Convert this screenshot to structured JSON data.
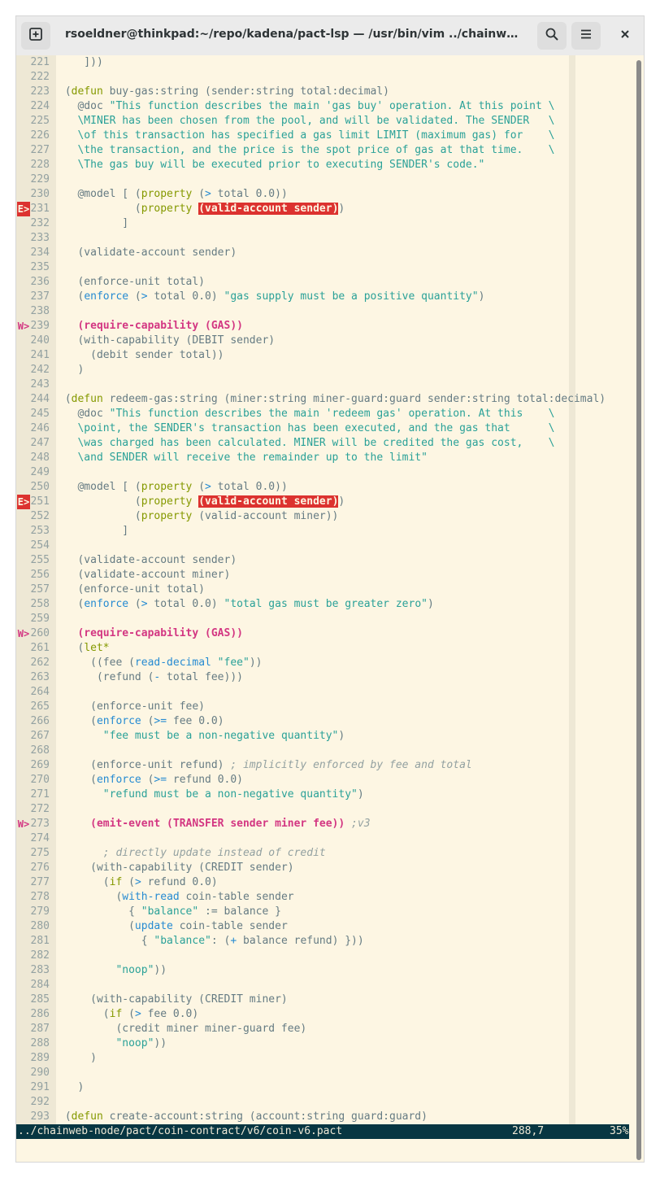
{
  "window": {
    "title": "rsoeldner@thinkpad:~/repo/kadena/pact-lsp — /usr/bin/vim ../chainweb-node/…",
    "new_tab_icon": "new-tab-icon",
    "search_icon": "search-icon",
    "menu_icon": "hamburger-menu-icon",
    "close_icon": "close-icon"
  },
  "editor": {
    "lines": [
      {
        "n": "221",
        "sign": "",
        "parts": [
          [
            "p",
            "    ]))"
          ]
        ]
      },
      {
        "n": "222",
        "sign": "",
        "parts": []
      },
      {
        "n": "223",
        "sign": "",
        "parts": [
          [
            "p",
            " ("
          ],
          [
            "k",
            "defun"
          ],
          [
            "p",
            " buy-gas:string (sender:string total:decimal)"
          ]
        ]
      },
      {
        "n": "224",
        "sign": "",
        "parts": [
          [
            "p",
            "   @doc "
          ],
          [
            "s",
            "\"This function describes the main 'gas buy' operation. At this point \\"
          ]
        ]
      },
      {
        "n": "225",
        "sign": "",
        "parts": [
          [
            "s",
            "   \\MINER has been chosen from the pool, and will be validated. The SENDER   \\"
          ]
        ]
      },
      {
        "n": "226",
        "sign": "",
        "parts": [
          [
            "s",
            "   \\of this transaction has specified a gas limit LIMIT (maximum gas) for    \\"
          ]
        ]
      },
      {
        "n": "227",
        "sign": "",
        "parts": [
          [
            "s",
            "   \\the transaction, and the price is the spot price of gas at that time.    \\"
          ]
        ]
      },
      {
        "n": "228",
        "sign": "",
        "parts": [
          [
            "s",
            "   \\The gas buy will be executed prior to executing SENDER's code.\""
          ]
        ]
      },
      {
        "n": "229",
        "sign": "",
        "parts": []
      },
      {
        "n": "230",
        "sign": "",
        "parts": [
          [
            "p",
            "   @model [ ("
          ],
          [
            "k",
            "property"
          ],
          [
            "p",
            " ("
          ],
          [
            "o",
            ">"
          ],
          [
            "p",
            " total 0.0))"
          ]
        ]
      },
      {
        "n": "231",
        "sign": "E>",
        "parts": [
          [
            "p",
            "            ("
          ],
          [
            "k",
            "property"
          ],
          [
            "p",
            " "
          ],
          [
            "e",
            "(valid-account sender)"
          ],
          [
            "p",
            ")"
          ]
        ]
      },
      {
        "n": "232",
        "sign": "",
        "parts": [
          [
            "p",
            "          ]"
          ]
        ]
      },
      {
        "n": "233",
        "sign": "",
        "parts": []
      },
      {
        "n": "234",
        "sign": "",
        "parts": [
          [
            "p",
            "   (validate-account sender)"
          ]
        ]
      },
      {
        "n": "235",
        "sign": "",
        "parts": []
      },
      {
        "n": "236",
        "sign": "",
        "parts": [
          [
            "p",
            "   (enforce-unit total)"
          ]
        ]
      },
      {
        "n": "237",
        "sign": "",
        "parts": [
          [
            "p",
            "   ("
          ],
          [
            "o",
            "enforce"
          ],
          [
            "p",
            " ("
          ],
          [
            "o",
            ">"
          ],
          [
            "p",
            " total 0.0) "
          ],
          [
            "s",
            "\"gas supply must be a positive quantity\""
          ],
          [
            "p",
            ")"
          ]
        ]
      },
      {
        "n": "238",
        "sign": "",
        "parts": []
      },
      {
        "n": "239",
        "sign": "W>",
        "parts": [
          [
            "p",
            "   "
          ],
          [
            "w",
            "(require-capability (GAS))"
          ]
        ]
      },
      {
        "n": "240",
        "sign": "",
        "parts": [
          [
            "p",
            "   (with-capability (DEBIT sender)"
          ]
        ]
      },
      {
        "n": "241",
        "sign": "",
        "parts": [
          [
            "p",
            "     (debit sender total))"
          ]
        ]
      },
      {
        "n": "242",
        "sign": "",
        "parts": [
          [
            "p",
            "   )"
          ]
        ]
      },
      {
        "n": "243",
        "sign": "",
        "parts": []
      },
      {
        "n": "244",
        "sign": "",
        "parts": [
          [
            "p",
            " ("
          ],
          [
            "k",
            "defun"
          ],
          [
            "p",
            " redeem-gas:string (miner:string miner-guard:guard sender:string total:decimal)"
          ]
        ]
      },
      {
        "n": "245",
        "sign": "",
        "parts": [
          [
            "p",
            "   @doc "
          ],
          [
            "s",
            "\"This function describes the main 'redeem gas' operation. At this    \\"
          ]
        ]
      },
      {
        "n": "246",
        "sign": "",
        "parts": [
          [
            "s",
            "   \\point, the SENDER's transaction has been executed, and the gas that      \\"
          ]
        ]
      },
      {
        "n": "247",
        "sign": "",
        "parts": [
          [
            "s",
            "   \\was charged has been calculated. MINER will be credited the gas cost,    \\"
          ]
        ]
      },
      {
        "n": "248",
        "sign": "",
        "parts": [
          [
            "s",
            "   \\and SENDER will receive the remainder up to the limit\""
          ]
        ]
      },
      {
        "n": "249",
        "sign": "",
        "parts": []
      },
      {
        "n": "250",
        "sign": "",
        "parts": [
          [
            "p",
            "   @model [ ("
          ],
          [
            "k",
            "property"
          ],
          [
            "p",
            " ("
          ],
          [
            "o",
            ">"
          ],
          [
            "p",
            " total 0.0))"
          ]
        ]
      },
      {
        "n": "251",
        "sign": "E>",
        "parts": [
          [
            "p",
            "            ("
          ],
          [
            "k",
            "property"
          ],
          [
            "p",
            " "
          ],
          [
            "e",
            "(valid-account sender)"
          ],
          [
            "p",
            ")"
          ]
        ]
      },
      {
        "n": "252",
        "sign": "",
        "parts": [
          [
            "p",
            "            ("
          ],
          [
            "k",
            "property"
          ],
          [
            "p",
            " (valid-account miner))"
          ]
        ]
      },
      {
        "n": "253",
        "sign": "",
        "parts": [
          [
            "p",
            "          ]"
          ]
        ]
      },
      {
        "n": "254",
        "sign": "",
        "parts": []
      },
      {
        "n": "255",
        "sign": "",
        "parts": [
          [
            "p",
            "   (validate-account sender)"
          ]
        ]
      },
      {
        "n": "256",
        "sign": "",
        "parts": [
          [
            "p",
            "   (validate-account miner)"
          ]
        ]
      },
      {
        "n": "257",
        "sign": "",
        "parts": [
          [
            "p",
            "   (enforce-unit total)"
          ]
        ]
      },
      {
        "n": "258",
        "sign": "",
        "parts": [
          [
            "p",
            "   ("
          ],
          [
            "o",
            "enforce"
          ],
          [
            "p",
            " ("
          ],
          [
            "o",
            ">"
          ],
          [
            "p",
            " total 0.0) "
          ],
          [
            "s",
            "\"total gas must be greater zero\""
          ],
          [
            "p",
            ")"
          ]
        ]
      },
      {
        "n": "259",
        "sign": "",
        "parts": []
      },
      {
        "n": "260",
        "sign": "W>",
        "parts": [
          [
            "p",
            "   "
          ],
          [
            "w",
            "(require-capability (GAS))"
          ]
        ]
      },
      {
        "n": "261",
        "sign": "",
        "parts": [
          [
            "p",
            "   ("
          ],
          [
            "k",
            "let*"
          ]
        ]
      },
      {
        "n": "262",
        "sign": "",
        "parts": [
          [
            "p",
            "     ((fee ("
          ],
          [
            "o",
            "read-decimal"
          ],
          [
            "p",
            " "
          ],
          [
            "s",
            "\"fee\""
          ],
          [
            "p",
            "))"
          ]
        ]
      },
      {
        "n": "263",
        "sign": "",
        "parts": [
          [
            "p",
            "      (refund ("
          ],
          [
            "o",
            "-"
          ],
          [
            "p",
            " total fee)))"
          ]
        ]
      },
      {
        "n": "264",
        "sign": "",
        "parts": []
      },
      {
        "n": "265",
        "sign": "",
        "parts": [
          [
            "p",
            "     (enforce-unit fee)"
          ]
        ]
      },
      {
        "n": "266",
        "sign": "",
        "parts": [
          [
            "p",
            "     ("
          ],
          [
            "o",
            "enforce"
          ],
          [
            "p",
            " ("
          ],
          [
            "o",
            ">="
          ],
          [
            "p",
            " fee 0.0)"
          ]
        ]
      },
      {
        "n": "267",
        "sign": "",
        "parts": [
          [
            "p",
            "       "
          ],
          [
            "s",
            "\"fee must be a non-negative quantity\""
          ],
          [
            "p",
            ")"
          ]
        ]
      },
      {
        "n": "268",
        "sign": "",
        "parts": []
      },
      {
        "n": "269",
        "sign": "",
        "parts": [
          [
            "p",
            "     (enforce-unit refund) "
          ],
          [
            "c",
            "; implicitly enforced by fee and total"
          ]
        ]
      },
      {
        "n": "270",
        "sign": "",
        "parts": [
          [
            "p",
            "     ("
          ],
          [
            "o",
            "enforce"
          ],
          [
            "p",
            " ("
          ],
          [
            "o",
            ">="
          ],
          [
            "p",
            " refund 0.0)"
          ]
        ]
      },
      {
        "n": "271",
        "sign": "",
        "parts": [
          [
            "p",
            "       "
          ],
          [
            "s",
            "\"refund must be a non-negative quantity\""
          ],
          [
            "p",
            ")"
          ]
        ]
      },
      {
        "n": "272",
        "sign": "",
        "parts": []
      },
      {
        "n": "273",
        "sign": "W>",
        "parts": [
          [
            "p",
            "     "
          ],
          [
            "w",
            "(emit-event (TRANSFER sender miner fee))"
          ],
          [
            "p",
            " "
          ],
          [
            "c",
            ";v3"
          ]
        ]
      },
      {
        "n": "274",
        "sign": "",
        "parts": []
      },
      {
        "n": "275",
        "sign": "",
        "parts": [
          [
            "p",
            "       "
          ],
          [
            "c",
            "; directly update instead of credit"
          ]
        ]
      },
      {
        "n": "276",
        "sign": "",
        "parts": [
          [
            "p",
            "     (with-capability (CREDIT sender)"
          ]
        ]
      },
      {
        "n": "277",
        "sign": "",
        "parts": [
          [
            "p",
            "       ("
          ],
          [
            "k",
            "if"
          ],
          [
            "p",
            " ("
          ],
          [
            "o",
            ">"
          ],
          [
            "p",
            " refund 0.0)"
          ]
        ]
      },
      {
        "n": "278",
        "sign": "",
        "parts": [
          [
            "p",
            "         ("
          ],
          [
            "o",
            "with-read"
          ],
          [
            "p",
            " coin-table sender"
          ]
        ]
      },
      {
        "n": "279",
        "sign": "",
        "parts": [
          [
            "p",
            "           { "
          ],
          [
            "s",
            "\"balance\""
          ],
          [
            "p",
            " := balance }"
          ]
        ]
      },
      {
        "n": "280",
        "sign": "",
        "parts": [
          [
            "p",
            "           ("
          ],
          [
            "o",
            "update"
          ],
          [
            "p",
            " coin-table sender"
          ]
        ]
      },
      {
        "n": "281",
        "sign": "",
        "parts": [
          [
            "p",
            "             { "
          ],
          [
            "s",
            "\"balance\""
          ],
          [
            "p",
            ": ("
          ],
          [
            "o",
            "+"
          ],
          [
            "p",
            " balance refund) }))"
          ]
        ]
      },
      {
        "n": "282",
        "sign": "",
        "parts": []
      },
      {
        "n": "283",
        "sign": "",
        "parts": [
          [
            "p",
            "         "
          ],
          [
            "s",
            "\"noop\""
          ],
          [
            "p",
            "))"
          ]
        ]
      },
      {
        "n": "284",
        "sign": "",
        "parts": []
      },
      {
        "n": "285",
        "sign": "",
        "parts": [
          [
            "p",
            "     (with-capability (CREDIT miner)"
          ]
        ]
      },
      {
        "n": "286",
        "sign": "",
        "parts": [
          [
            "p",
            "       ("
          ],
          [
            "k",
            "if"
          ],
          [
            "p",
            " ("
          ],
          [
            "o",
            ">"
          ],
          [
            "p",
            " fee 0.0)"
          ]
        ]
      },
      {
        "n": "287",
        "sign": "",
        "parts": [
          [
            "p",
            "         (credit miner miner-guard fee)"
          ]
        ]
      },
      {
        "n": "288",
        "sign": "",
        "parts": [
          [
            "p",
            "         "
          ],
          [
            "s",
            "\"noop\""
          ],
          [
            "p",
            "))"
          ]
        ]
      },
      {
        "n": "289",
        "sign": "",
        "parts": [
          [
            "p",
            "     )"
          ]
        ]
      },
      {
        "n": "290",
        "sign": "",
        "parts": []
      },
      {
        "n": "291",
        "sign": "",
        "parts": [
          [
            "p",
            "   )"
          ]
        ]
      },
      {
        "n": "292",
        "sign": "",
        "parts": []
      },
      {
        "n": "293",
        "sign": "",
        "parts": [
          [
            "p",
            " ("
          ],
          [
            "k",
            "defun"
          ],
          [
            "p",
            " create-account:string (account:string guard:guard)"
          ]
        ]
      }
    ]
  },
  "statusline": {
    "path": "../chainweb-node/pact/coin-contract/v6/coin-v6.pact",
    "position": "288,7",
    "percent": "35%"
  },
  "colors": {
    "background": "#fdf6e3",
    "gutter": "#eee8d5",
    "statusline": "#073642",
    "error": "#dc322f",
    "warning": "#d33682"
  }
}
